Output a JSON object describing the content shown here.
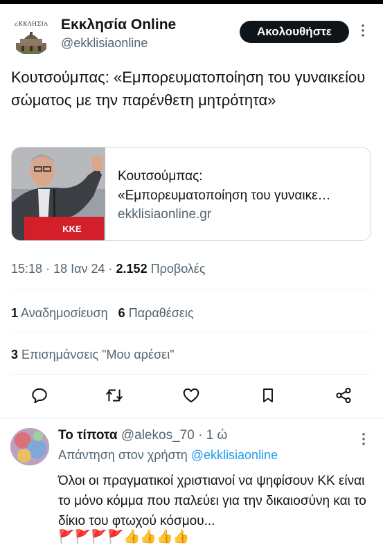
{
  "author": {
    "name": "Εκκλησία Online",
    "handle": "@ekklisiaonline",
    "logo_text": "ΕΚΚΛΗΣΙΑ",
    "follow_label": "Ακολουθήστε"
  },
  "tweet": {
    "text": "Κουτσούμπας: «Εμπορευματοποίηση του γυναικείου σώματος με την παρένθετη μητρότητα»",
    "card": {
      "title_line1": "Κουτσούμπας:",
      "title_line2": "«Εμπορευματοποίηση του γυναικε…",
      "domain": "ekklisiaonline.gr",
      "podium_text": "ΚΚΕ"
    },
    "time": "15:18",
    "date": "18 Ιαν 24",
    "views_count": "2.152",
    "views_label": "Προβολές",
    "reposts_count": "1",
    "reposts_label": "Αναδημοσίευση",
    "quotes_count": "6",
    "quotes_label": "Παραθέσεις",
    "likes_count": "3",
    "likes_label": "Επισημάνσεις \"Μου αρέσει\""
  },
  "actions": {
    "icons": [
      "reply-icon",
      "retweet-icon",
      "heart-icon",
      "bookmark-icon",
      "share-icon"
    ]
  },
  "reply": {
    "name": "Το τίποτα",
    "handle": "@alekos_70",
    "time": "1 ώ",
    "reply_to_label": "Απάντηση στον χρήστη",
    "reply_to_mention": "@ekklisiaonline",
    "text": "Όλοι οι πραγματικοί χριστιανοί να ψηφίσουν ΚΚ είναι το μόνο κόμμα που παλεύει για την δικαιοσύνη και το δίκιο του φτωχού κόσμου...",
    "emojis": "🚩🚩🚩🚩👍👍👍👍"
  },
  "colors": {
    "text": "#0f1419",
    "secondary": "#536471",
    "mention": "#1d9bf0",
    "border": "#cfd9de",
    "follow_bg": "#0f1419"
  }
}
